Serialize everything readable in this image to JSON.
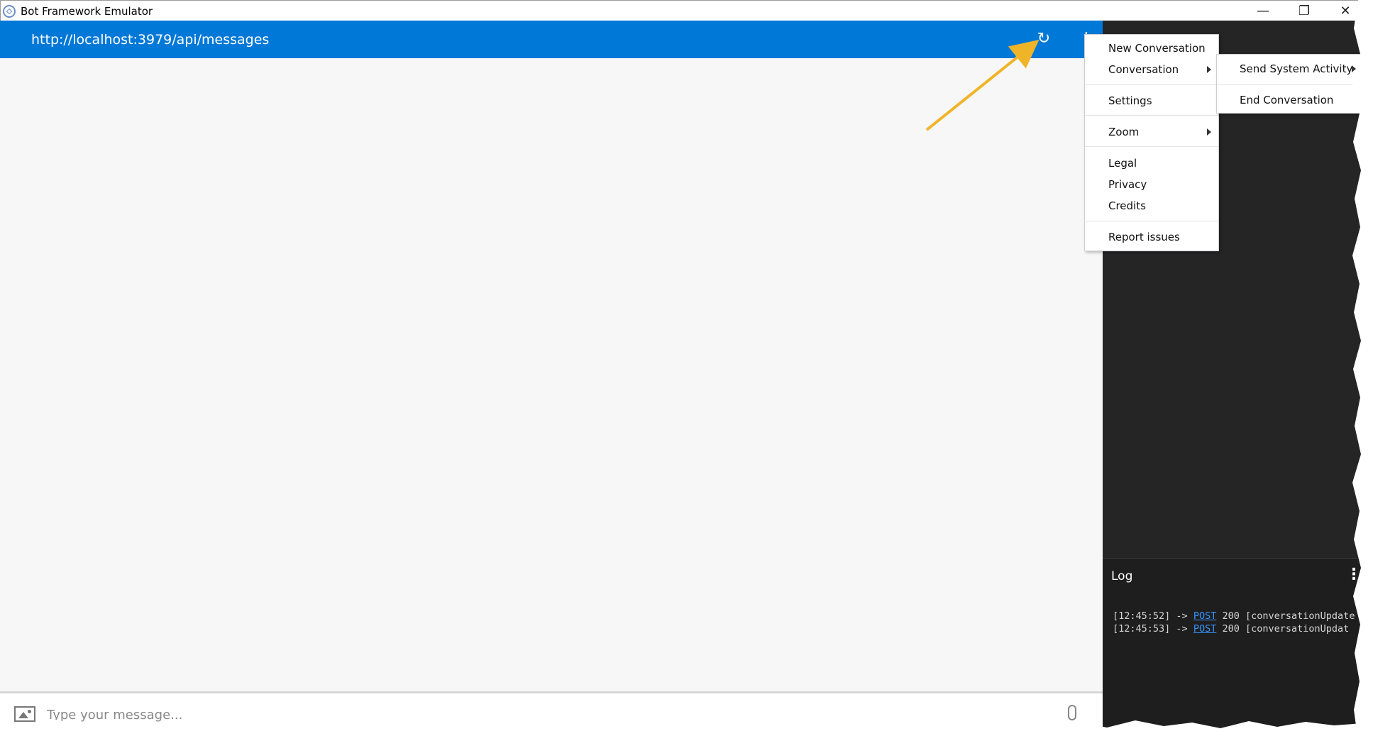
{
  "window": {
    "title": "Bot Framework Emulator",
    "minimize_glyph": "—",
    "restore_glyph": "❐",
    "close_glyph": "✕"
  },
  "chat": {
    "endpoint_url": "http://localhost:3979/api/messages",
    "refresh_glyph": "↻",
    "more_glyph": "⋮",
    "input_placeholder": "Type your message..."
  },
  "menu": {
    "items": [
      {
        "label": "New Conversation"
      },
      {
        "label": "Conversation",
        "has_submenu": true
      },
      {
        "label": "Settings"
      },
      {
        "label": "Zoom",
        "has_submenu": true
      },
      {
        "label": "Legal"
      },
      {
        "label": "Privacy"
      },
      {
        "label": "Credits"
      },
      {
        "label": "Report issues"
      }
    ],
    "submenu": [
      {
        "label": "Send System Activity",
        "has_submenu": true
      },
      {
        "label": "End Conversation"
      }
    ]
  },
  "log": {
    "title": "Log",
    "more_glyph": "⋮",
    "entries": [
      {
        "time": "[12:45:52]",
        "arrow": "->",
        "method": "POST",
        "status": "200",
        "detail": "[conversationUpdate"
      },
      {
        "time": "[12:45:53]",
        "arrow": "->",
        "method": "POST",
        "status": "200",
        "detail": "[conversationUpdat"
      }
    ]
  },
  "colors": {
    "header_blue": "#0078d7",
    "annotation_arrow": "#f0b429",
    "log_link": "#3794ff",
    "dark_panel": "#252526"
  }
}
